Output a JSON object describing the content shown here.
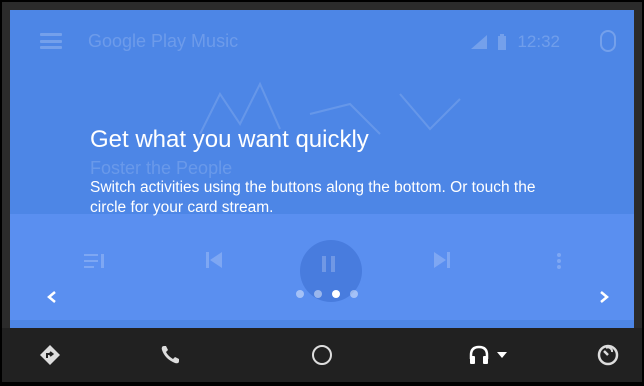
{
  "app": {
    "title": "Google Play Music",
    "status": {
      "time": "12:32"
    }
  },
  "background": {
    "artist": "Foster the People"
  },
  "onboarding": {
    "heading": "Get what you want quickly",
    "body": "Switch activities using the buttons along the bottom. Or touch the circle for your card stream.",
    "page_count": 4,
    "active_page_index": 2
  },
  "nav": {
    "prev_icon": "chevron-left-icon",
    "next_icon": "chevron-right-icon"
  },
  "bottom_nav": {
    "items": [
      {
        "name": "navigation",
        "icon": "directions-icon"
      },
      {
        "name": "phone",
        "icon": "phone-icon"
      },
      {
        "name": "home",
        "icon": "home-circle-icon"
      },
      {
        "name": "music",
        "icon": "headphones-icon"
      },
      {
        "name": "exit",
        "icon": "exit-icon"
      }
    ]
  },
  "colors": {
    "accent": "#4d86e6",
    "bottom_bar": "#212121"
  }
}
